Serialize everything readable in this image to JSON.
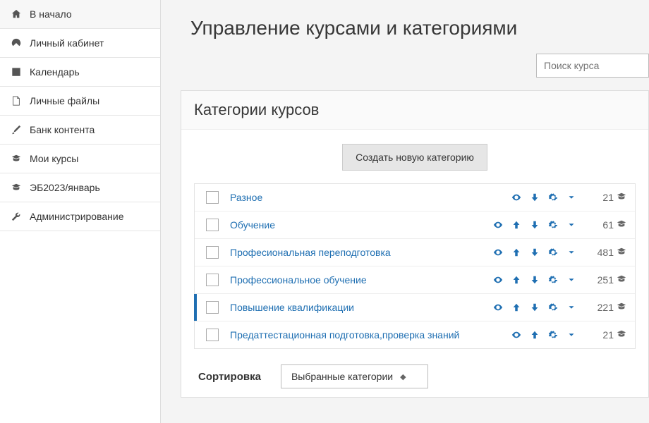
{
  "sidebar": {
    "items": [
      {
        "label": "В начало",
        "icon": "home"
      },
      {
        "label": "Личный кабинет",
        "icon": "dashboard"
      },
      {
        "label": "Календарь",
        "icon": "calendar"
      },
      {
        "label": "Личные файлы",
        "icon": "file"
      },
      {
        "label": "Банк контента",
        "icon": "brush"
      },
      {
        "label": "Мои курсы",
        "icon": "cap"
      },
      {
        "label": "ЭБ2023/январь",
        "icon": "cap"
      },
      {
        "label": "Администрирование",
        "icon": "wrench"
      }
    ]
  },
  "page": {
    "title": "Управление курсами и категориями",
    "search_placeholder": "Поиск курса"
  },
  "card": {
    "header": "Категории курсов",
    "create_button": "Создать новую категорию"
  },
  "categories": [
    {
      "name": "Разное",
      "count": "21",
      "actions": [
        "eye",
        "down",
        "gear"
      ]
    },
    {
      "name": "Обучение",
      "count": "61",
      "actions": [
        "eye",
        "up",
        "down",
        "gear"
      ]
    },
    {
      "name": "Професиональная переподготовка",
      "count": "481",
      "actions": [
        "eye",
        "up",
        "down",
        "gear"
      ]
    },
    {
      "name": "Профессиональное обучение",
      "count": "251",
      "actions": [
        "eye",
        "up",
        "down",
        "gear"
      ]
    },
    {
      "name": "Повышение квалификации",
      "count": "221",
      "actions": [
        "eye",
        "up",
        "down",
        "gear"
      ],
      "selected": true
    },
    {
      "name": "Предаттестационная подготовка,проверка знаний",
      "count": "21",
      "actions": [
        "eye",
        "up",
        "gear"
      ]
    }
  ],
  "sort": {
    "label": "Сортировка",
    "select": "Выбранные категории"
  },
  "colors": {
    "link": "#1f6fb2"
  }
}
